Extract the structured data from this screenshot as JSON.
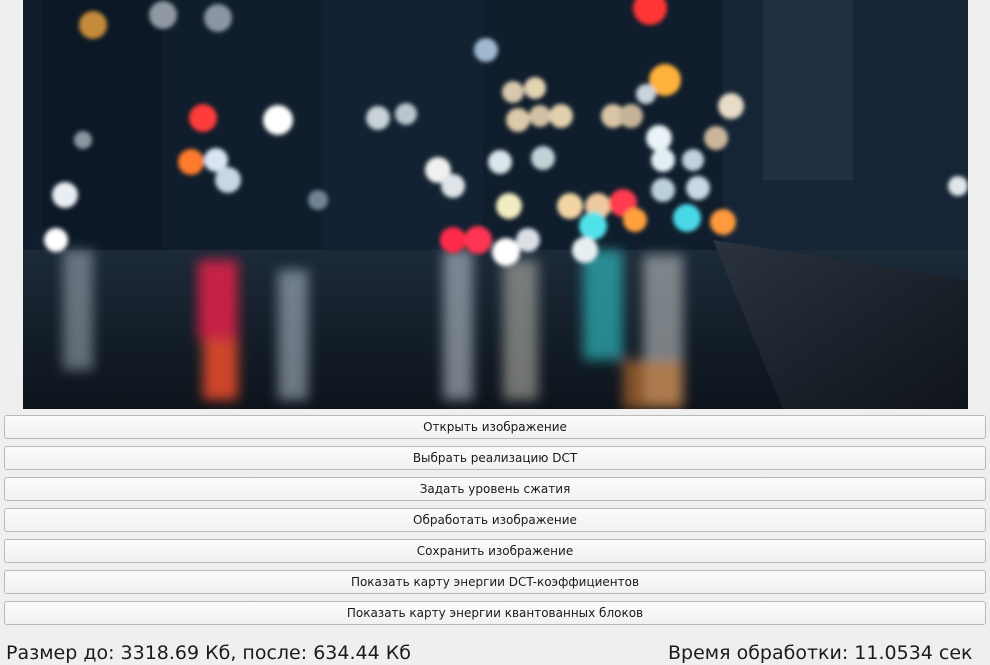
{
  "image_preview": {
    "description_icon": "bokeh-photo"
  },
  "buttons": {
    "open": "Открыть изображение",
    "choose_dct": "Выбрать реализацию DCT",
    "set_compression": "Задать уровень сжатия",
    "process": "Обработать изображение",
    "save": "Сохранить изображение",
    "dct_energy_map": "Показать карту энергии DCT-коэффициентов",
    "quant_energy_map": "Показать карту энергии квантованных блоков"
  },
  "status": {
    "size_text": "Размер до: 3318.69 Кб, после: 634.44 Кб",
    "time_text": "Время обработки: 11.0534 сек"
  }
}
